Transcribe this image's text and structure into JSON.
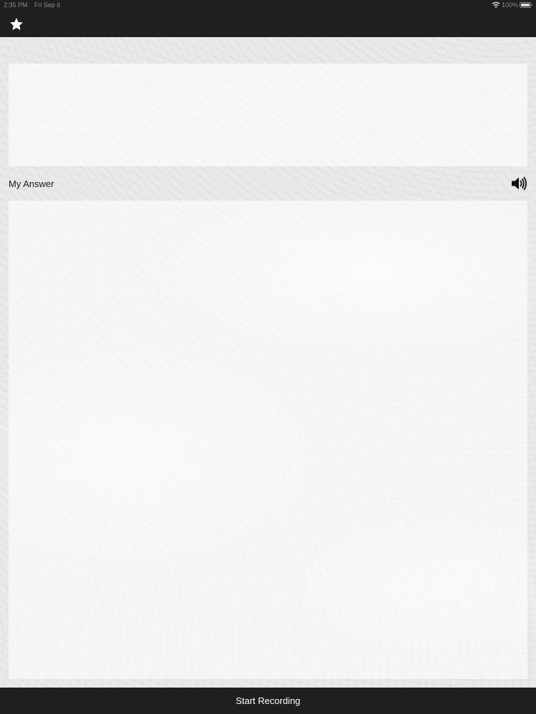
{
  "status_bar": {
    "time": "2:35 PM",
    "date": "Fri Sep 6",
    "battery_percent": "100%"
  },
  "nav_bar": {
    "favorite_icon": "star-icon"
  },
  "answer_section": {
    "label": "My Answer",
    "speaker_icon": "speaker-icon"
  },
  "bottom_bar": {
    "record_label": "Start Recording"
  },
  "colors": {
    "bar_background": "#1f1e21",
    "page_background": "#e9e9eb",
    "panel_background": "#f6f6f7",
    "bar_text": "#ffffff"
  }
}
